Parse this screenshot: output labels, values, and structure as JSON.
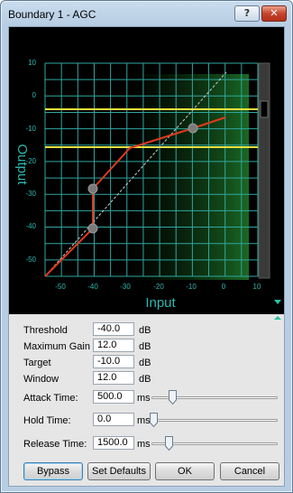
{
  "window": {
    "title": "Boundary 1 - AGC",
    "help_label": "?",
    "close_label": "✕"
  },
  "graph": {
    "x_axis_label": "Input",
    "y_axis_label": "Output",
    "x_ticks": [
      "-50",
      "-40",
      "-30",
      "-20",
      "-10",
      "0",
      "10"
    ],
    "y_ticks": [
      "10",
      "0",
      "-10",
      "-20",
      "-30",
      "-40",
      "-50"
    ]
  },
  "params": {
    "threshold_label": "Threshold",
    "threshold_value": "-40.0",
    "threshold_unit": "dB",
    "max_gain_label": "Maximum Gain",
    "max_gain_value": "12.0",
    "max_gain_unit": "dB",
    "target_label": "Target",
    "target_value": "-10.0",
    "target_unit": "dB",
    "window_label": "Window",
    "window_value": "12.0",
    "window_unit": "dB",
    "attack_label": "Attack Time:",
    "attack_value": "500.0",
    "attack_unit": "ms",
    "hold_label": "Hold Time:",
    "hold_value": "0.0",
    "hold_unit": "ms",
    "release_label": "Release Time:",
    "release_value": "1500.0",
    "release_unit": "ms"
  },
  "buttons": {
    "bypass": "Bypass",
    "set_defaults": "Set Defaults",
    "ok": "OK",
    "cancel": "Cancel"
  },
  "colors": {
    "grid": "#2fa7a0",
    "curve": "#e03a1e",
    "window_lines": "#e8e040",
    "axis_text": "#2bb8b0"
  }
}
